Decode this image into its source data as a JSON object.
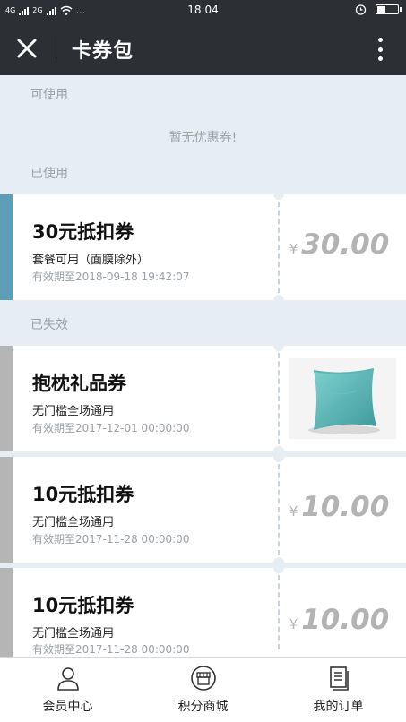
{
  "status_bar": {
    "network_1": "4G",
    "network_2": "2G",
    "extra": "...",
    "time": "18:04",
    "battery_level": 0.45
  },
  "app_bar": {
    "title": "卡券包",
    "close_icon": "close-icon",
    "more_icon": "more-vertical-icon"
  },
  "sections": {
    "usable": {
      "label": "可使用",
      "empty_text": "暂无优惠券!"
    },
    "used": {
      "label": "已使用"
    },
    "expired": {
      "label": "已失效"
    }
  },
  "coupons": [
    {
      "name": "30元抵扣券",
      "desc": "套餐可用（面膜除外）",
      "expiry": "有效期至2018-09-18 19:42:07",
      "currency": "¥",
      "amount": "30.00",
      "stripe_color": "#5e9db7"
    },
    {
      "name": "抱枕礼品券",
      "desc": "无门槛全场通用",
      "expiry": "有效期至2017-12-01 00:00:00",
      "image": "pillow",
      "stripe_color": "#b5b5b5"
    },
    {
      "name": "10元抵扣券",
      "desc": "无门槛全场通用",
      "expiry": "有效期至2017-11-28 00:00:00",
      "currency": "¥",
      "amount": "10.00",
      "stripe_color": "#b5b5b5"
    },
    {
      "name": "10元抵扣券",
      "desc": "无门槛全场通用",
      "expiry": "有效期至2017-11-28 00:00:00",
      "currency": "¥",
      "amount": "10.00",
      "stripe_color": "#b5b5b5"
    }
  ],
  "bottom_nav": [
    {
      "label": "会员中心",
      "icon": "user-icon"
    },
    {
      "label": "积分商城",
      "icon": "shop-icon"
    },
    {
      "label": "我的订单",
      "icon": "order-list-icon"
    }
  ],
  "colors": {
    "app_bar_bg": "#2c2f33",
    "page_bg": "#e6edf3",
    "active_stripe": "#5e9db7",
    "expired_stripe": "#b5b5b5",
    "amount_text": "#b3b3b3"
  }
}
